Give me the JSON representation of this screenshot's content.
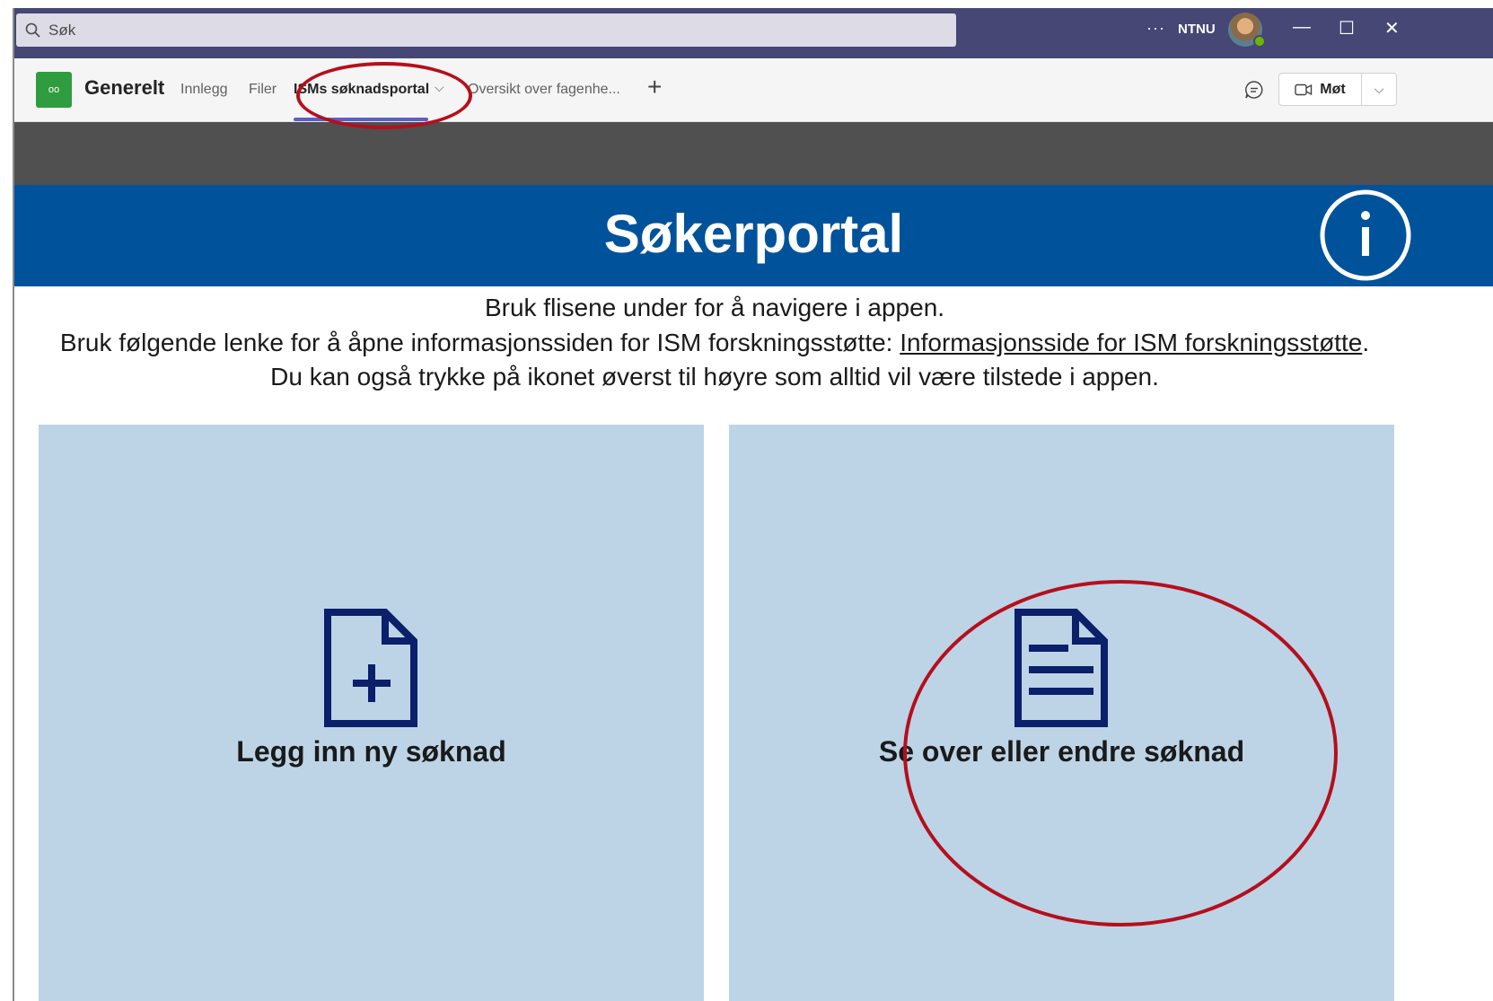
{
  "titlebar": {
    "search_placeholder": "Søk",
    "more_label": "···",
    "org_label": "NTNU",
    "minimize": "—",
    "maximize": "☐",
    "close": "✕"
  },
  "channel": {
    "team_initials": "oo",
    "name": "Generelt",
    "tabs": [
      {
        "label": "Innlegg"
      },
      {
        "label": "Filer"
      },
      {
        "label": "ISMs søknadsportal"
      },
      {
        "label": "Oversikt over fagenhe..."
      }
    ],
    "add_tab": "+",
    "meet_label": "Møt",
    "meet_dropdown": "⌵"
  },
  "app": {
    "banner_title": "Søkerportal",
    "intro_line1": "Bruk flisene under for å navigere i appen.",
    "intro_line2_prefix": "Bruk følgende lenke for å åpne informasjonssiden for ISM forskningsstøtte: ",
    "intro_line2_link": "Informasjonsside for ISM forskningsstøtte",
    "intro_line2_suffix": ".",
    "intro_line3": "Du kan også trykke på ikonet øverst til høyre som alltid vil være tilstede i appen.",
    "tiles": [
      {
        "label": "Legg inn ny søknad",
        "icon": "new-document-icon"
      },
      {
        "label": "Se over eller endre søknad",
        "icon": "document-lines-icon"
      }
    ]
  },
  "colors": {
    "titlebar": "#464775",
    "banner": "#00529b",
    "tile": "#bdd4e7",
    "icon": "#0b1f6b",
    "annotation": "#b50f1c"
  }
}
